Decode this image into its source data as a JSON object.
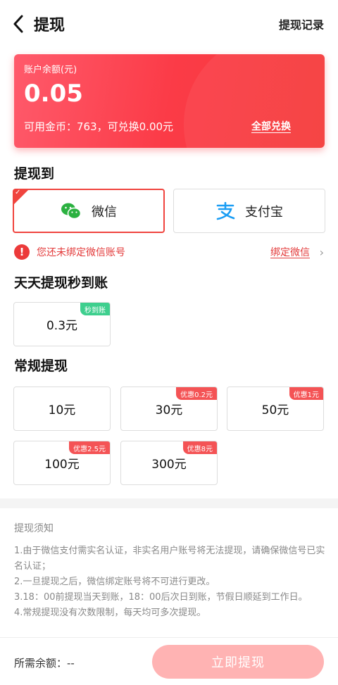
{
  "header": {
    "title": "提现",
    "history_label": "提现记录"
  },
  "balance": {
    "label": "账户余额(元)",
    "value": "0.05",
    "coin_text": "可用金币：763，可兑换0.00元",
    "convert_all_label": "全部兑换"
  },
  "withdraw_to": {
    "title": "提现到",
    "methods": [
      {
        "label": "微信",
        "icon": "wechat-icon",
        "selected": true
      },
      {
        "label": "支付宝",
        "icon": "alipay-icon",
        "selected": false
      }
    ],
    "warning": "您还未绑定微信账号",
    "bind_label": "绑定微信"
  },
  "instant": {
    "title": "天天提现秒到账",
    "items": [
      {
        "amount": "0.3元",
        "tag": "秒到账"
      }
    ]
  },
  "regular": {
    "title": "常规提现",
    "items": [
      {
        "amount": "10元",
        "tag": ""
      },
      {
        "amount": "30元",
        "tag": "优惠0.2元"
      },
      {
        "amount": "50元",
        "tag": "优惠1元"
      },
      {
        "amount": "100元",
        "tag": "优惠2.5元"
      },
      {
        "amount": "300元",
        "tag": "优惠8元"
      }
    ]
  },
  "notice": {
    "title": "提现须知",
    "lines": [
      "1.由于微信支付需实名认证，非实名用户账号将无法提现，请确保微信号已实名认证；",
      "2.一旦提现之后，微信绑定账号将不可进行更改。",
      "3.18：00前提现当天到账，18：00后次日到账，节假日顺延到工作日。",
      "4.常规提现没有次数限制，每天均可多次提现。"
    ]
  },
  "footer": {
    "need_label": "所需余额：--",
    "submit_label": "立即提现"
  },
  "colors": {
    "accent": "#f0443e",
    "card_start": "#ff5a6b",
    "card_end": "#f53a39",
    "green_tag": "#3ecf8e",
    "button_disabled": "#ffb3b3"
  }
}
